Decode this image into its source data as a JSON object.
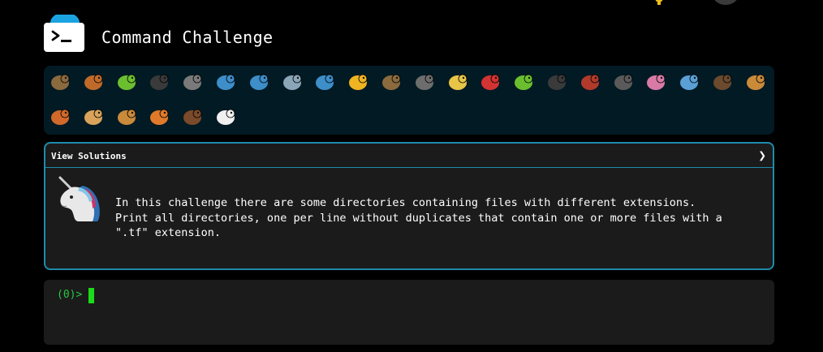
{
  "header": {
    "title": "Command Challenge",
    "logo_icon": "terminal-prompt-icon"
  },
  "animal_icons": [
    {
      "name": "snail-icon",
      "color": "#8b6a3e",
      "row": 1
    },
    {
      "name": "butterfly-icon",
      "color": "#c06a2a",
      "row": 1
    },
    {
      "name": "caterpillar-icon",
      "color": "#6bbf2f",
      "row": 1
    },
    {
      "name": "ant-icon",
      "color": "#3a3a3a",
      "row": 1
    },
    {
      "name": "spider-web-icon",
      "color": "#7a7a7a",
      "row": 1
    },
    {
      "name": "whale-icon",
      "color": "#3d8ec9",
      "row": 1
    },
    {
      "name": "shark-icon",
      "color": "#3d8ec9",
      "row": 1
    },
    {
      "name": "dolphin-icon",
      "color": "#8aa6b8",
      "row": 1
    },
    {
      "name": "fish-icon",
      "color": "#3d8ec9",
      "row": 1
    },
    {
      "name": "tropical-fish-icon",
      "color": "#f0b322",
      "row": 1
    },
    {
      "name": "blowfish-icon",
      "color": "#8b6a3e",
      "row": 1
    },
    {
      "name": "wolf-icon",
      "color": "#6d6d6d",
      "row": 1
    },
    {
      "name": "bee-icon",
      "color": "#e8c547",
      "row": 1
    },
    {
      "name": "ladybug-icon",
      "color": "#d23333",
      "row": 1
    },
    {
      "name": "cricket-icon",
      "color": "#6bbf2f",
      "row": 1
    },
    {
      "name": "spider-icon",
      "color": "#3a3a3a",
      "row": 1
    },
    {
      "name": "scorpion-icon",
      "color": "#b23a2a",
      "row": 1
    },
    {
      "name": "fly-icon",
      "color": "#5a5a5a",
      "row": 1
    },
    {
      "name": "worm-icon",
      "color": "#d97aa6",
      "row": 1
    },
    {
      "name": "microbe-icon",
      "color": "#5aa0d6",
      "row": 1
    },
    {
      "name": "monkey-icon",
      "color": "#6b4a2e",
      "row": 1
    },
    {
      "name": "dog-icon",
      "color": "#c98a3a",
      "row": 1
    },
    {
      "name": "fox-icon",
      "color": "#d2692a",
      "row": 2
    },
    {
      "name": "cat-icon",
      "color": "#d8a35a",
      "row": 2
    },
    {
      "name": "lion-icon",
      "color": "#c98a3a",
      "row": 2
    },
    {
      "name": "tiger-icon",
      "color": "#e07a2a",
      "row": 2
    },
    {
      "name": "horse-icon",
      "color": "#7a4a2a",
      "row": 2
    },
    {
      "name": "unicorn-icon",
      "color": "#f0f0f0",
      "row": 2
    }
  ],
  "card": {
    "header_label": "View Solutions",
    "chevron": "❯",
    "avatar_icon": "unicorn-icon",
    "description": "In this challenge there are some directories containing files with different extensions.\nPrint all directories, one per line without duplicates that contain one or more files with a\n\".tf\" extension."
  },
  "terminal": {
    "prompt": "(0)>"
  },
  "colors": {
    "accent": "#1f8bab",
    "panel_bg": "#021a24",
    "card_bg": "#1b1b1b",
    "prompt_green": "#27c93f",
    "logo_blue": "#1aa3e0"
  }
}
